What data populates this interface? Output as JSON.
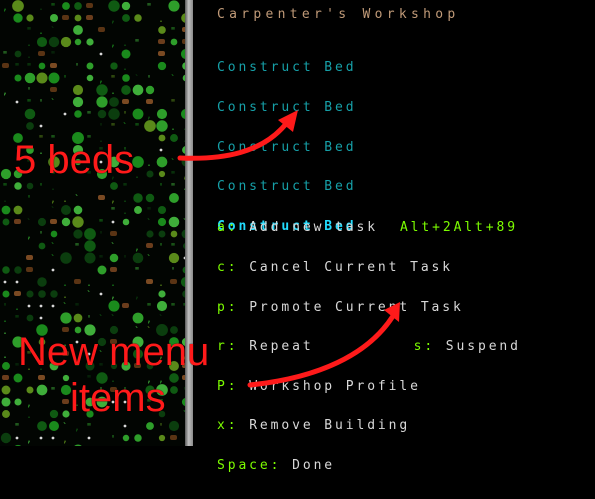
{
  "workshop": {
    "title": "Carpenter's Workshop"
  },
  "tasks": [
    {
      "label": "Construct Bed",
      "selected": false
    },
    {
      "label": "Construct Bed",
      "selected": false
    },
    {
      "label": "Construct Bed",
      "selected": false
    },
    {
      "label": "Construct Bed",
      "selected": false
    },
    {
      "label": "Construct Bed",
      "selected": true
    }
  ],
  "menu": {
    "add": {
      "key": "a",
      "label": "Add new task",
      "hotkeys": "Alt+2Alt+89"
    },
    "cancel": {
      "key": "c",
      "label": "Cancel Current Task"
    },
    "promote": {
      "key": "p",
      "label": "Promote Current Task"
    },
    "repeat": {
      "key": "r",
      "label": "Repeat"
    },
    "suspend": {
      "key": "s",
      "label": "Suspend"
    },
    "profile": {
      "key": "P",
      "label": "Workshop Profile"
    },
    "remove": {
      "key": "x",
      "label": "Remove Building"
    },
    "done": {
      "key": "Space",
      "label": "Done"
    }
  },
  "annotations": {
    "beds": "5 beds",
    "menu_line1": "New menu",
    "menu_line2": "items",
    "color": "#ff1a1a"
  },
  "colors": {
    "panel_bg": "#000000",
    "title": "#c09a78",
    "task": "#16a0a8",
    "task_selected": "#22ddff",
    "hotkey": "#7cfc00",
    "menu_text": "#d8d8d8",
    "annotation": "#ff1a1a"
  }
}
